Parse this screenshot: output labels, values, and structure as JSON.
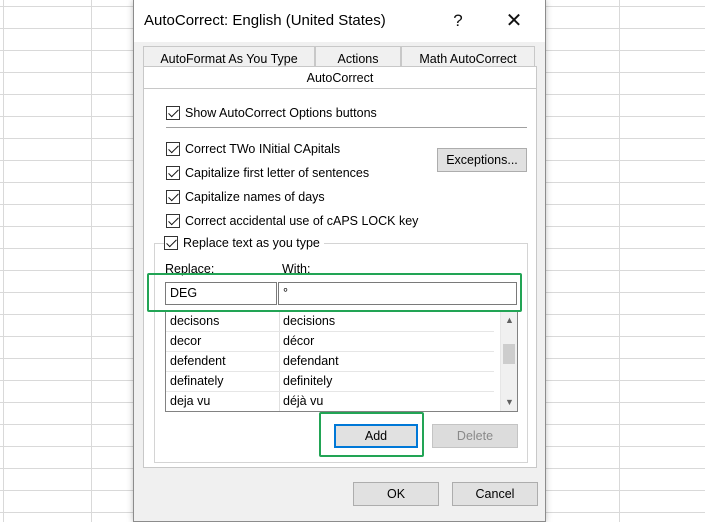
{
  "dialog": {
    "title": "AutoCorrect: English (United States)",
    "help_label": "?",
    "close_label": "✕"
  },
  "tabs": [
    {
      "label": "AutoFormat As You Type"
    },
    {
      "label": "Actions"
    },
    {
      "label": "Math AutoCorrect"
    },
    {
      "label": "AutoCorrect"
    }
  ],
  "options": {
    "show_buttons": {
      "label": "Show AutoCorrect Options buttons",
      "checked": true
    },
    "two_initial_caps": {
      "label": "Correct TWo INitial CApitals",
      "checked": true
    },
    "capitalize_first": {
      "label": "Capitalize first letter of sentences",
      "checked": true
    },
    "capitalize_days": {
      "label": "Capitalize names of days",
      "checked": true
    },
    "caps_lock": {
      "label": "Correct accidental use of cAPS LOCK key",
      "checked": true
    },
    "replace_text": {
      "label": "Replace text as you type",
      "checked": true
    }
  },
  "exceptions_label": "Exceptions...",
  "replace": {
    "replace_label": "Replace:",
    "with_label": "With:",
    "replace_value": "DEG",
    "with_value": "°"
  },
  "list": {
    "rows": [
      {
        "replace": "decisons",
        "with": "decisions"
      },
      {
        "replace": "decor",
        "with": "décor"
      },
      {
        "replace": "defendent",
        "with": "defendant"
      },
      {
        "replace": "definately",
        "with": "definitely"
      },
      {
        "replace": "deja vu",
        "with": "déjà vu"
      }
    ]
  },
  "add_label": "Add",
  "delete_label": "Delete",
  "ok_label": "OK",
  "cancel_label": "Cancel"
}
